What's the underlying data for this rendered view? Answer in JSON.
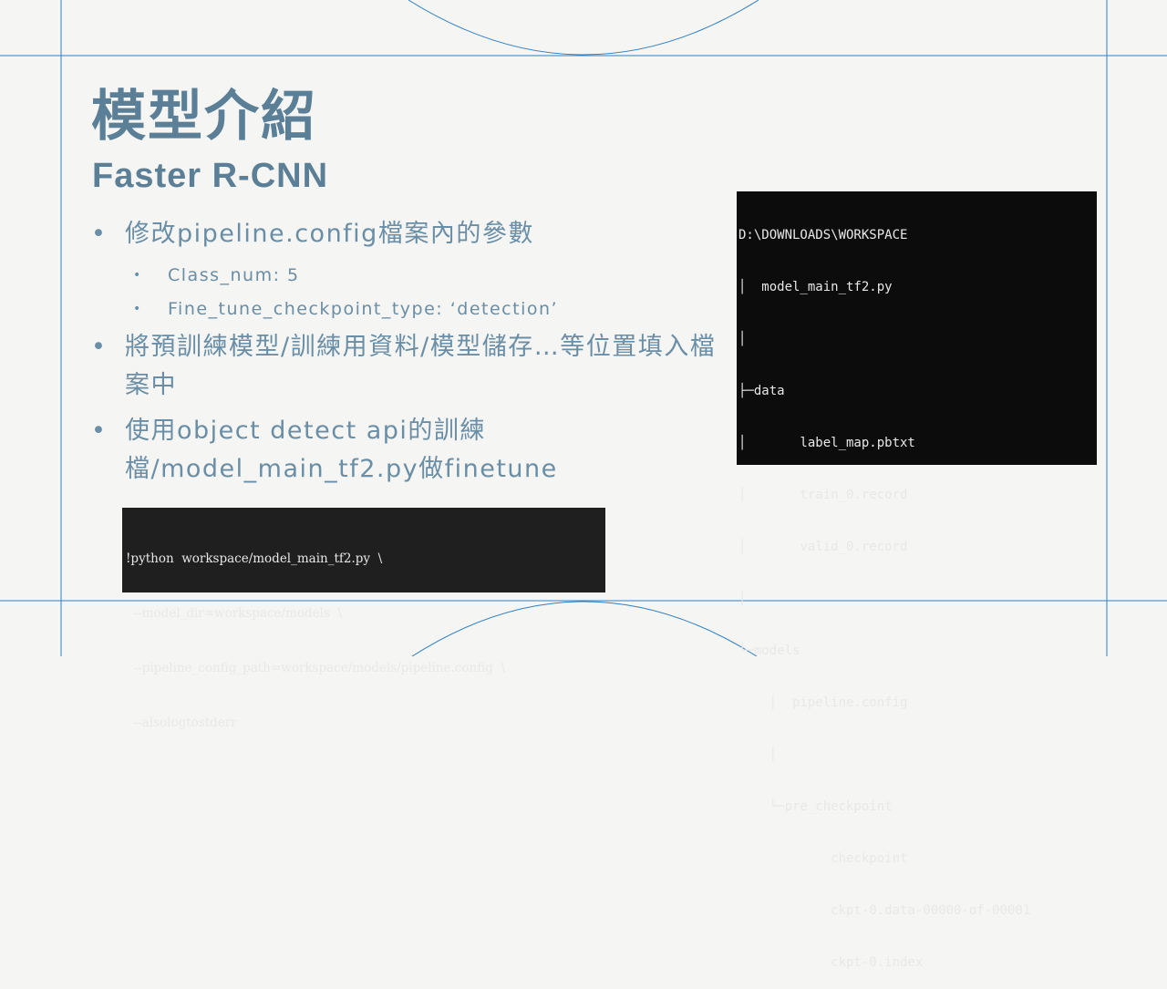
{
  "slide": {
    "title": "模型介紹",
    "subtitle": "Faster R-CNN",
    "bullets": [
      {
        "text": "修改pipeline.config檔案內的參數"
      },
      {
        "text": "Class_num: 5"
      },
      {
        "text": "Fine_tune_checkpoint_type: ‘detection’"
      },
      {
        "text": "將預訓練模型/訓練用資料/模型儲存…等位置填入檔案中"
      },
      {
        "text": "使用object detect api的訓練檔/model_main_tf2.py做finetune"
      }
    ],
    "bullet_symbol": "•",
    "code_lines": [
      "!python  workspace/model_main_tf2.py  \\",
      "  --model_dir=workspace/models  \\",
      "  --pipeline_config_path=workspace/models/pipeline.config  \\",
      "  --alsologtostderr"
    ],
    "tree_lines": [
      "D:\\DOWNLOADS\\WORKSPACE",
      "│  model_main_tf2.py",
      "│",
      "├─data",
      "│       label_map.pbtxt",
      "│       train_0.record",
      "│       valid_0.record",
      "│",
      "└─models",
      "    │  pipeline.config",
      "    │",
      "    └─pre_checkpoint",
      "            checkpoint",
      "            ckpt-0.data-00000-of-00001",
      "            ckpt-0.index"
    ]
  },
  "colors": {
    "background": "#f5f5f3",
    "accent_line": "#2f7fc1",
    "title": "#5b7f97",
    "body_text": "#6a8ea6",
    "code_bg": "#1f1f1f",
    "terminal_bg": "#0c0c0c"
  }
}
